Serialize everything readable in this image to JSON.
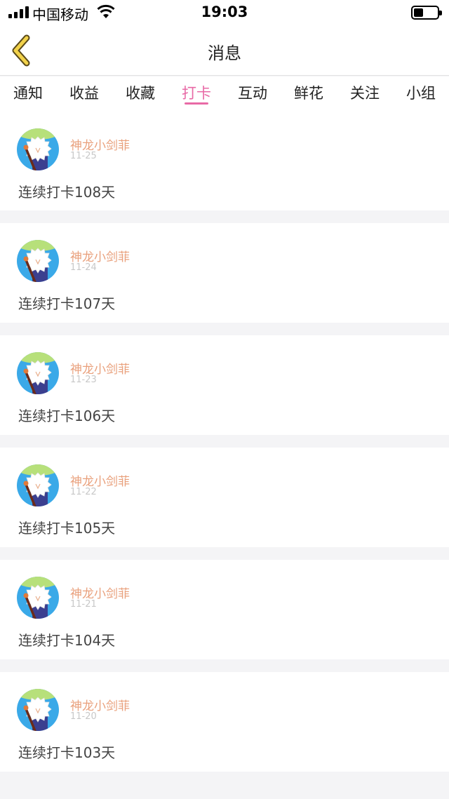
{
  "status_bar": {
    "carrier": "中国移动",
    "time": "19:03",
    "battery_level": 0.4
  },
  "nav": {
    "title": "消息",
    "back_icon": "chevron-left-icon",
    "accent": "#f2d24a"
  },
  "tabs": [
    {
      "label": "通知",
      "active": false
    },
    {
      "label": "收益",
      "active": false
    },
    {
      "label": "收藏",
      "active": false
    },
    {
      "label": "打卡",
      "active": true
    },
    {
      "label": "互动",
      "active": false
    },
    {
      "label": "鲜花",
      "active": false
    },
    {
      "label": "关注",
      "active": false
    },
    {
      "label": "小组",
      "active": false
    }
  ],
  "colors": {
    "active_tab": "#e86aa6",
    "username": "#e9a07c",
    "date": "#c8c8c8"
  },
  "messages": [
    {
      "username": "神龙小剑菲",
      "date": "11-25",
      "text": "连续打卡108天"
    },
    {
      "username": "神龙小剑菲",
      "date": "11-24",
      "text": "连续打卡107天"
    },
    {
      "username": "神龙小剑菲",
      "date": "11-23",
      "text": "连续打卡106天"
    },
    {
      "username": "神龙小剑菲",
      "date": "11-22",
      "text": "连续打卡105天"
    },
    {
      "username": "神龙小剑菲",
      "date": "11-21",
      "text": "连续打卡104天"
    },
    {
      "username": "神龙小剑菲",
      "date": "11-20",
      "text": "连续打卡103天"
    }
  ]
}
